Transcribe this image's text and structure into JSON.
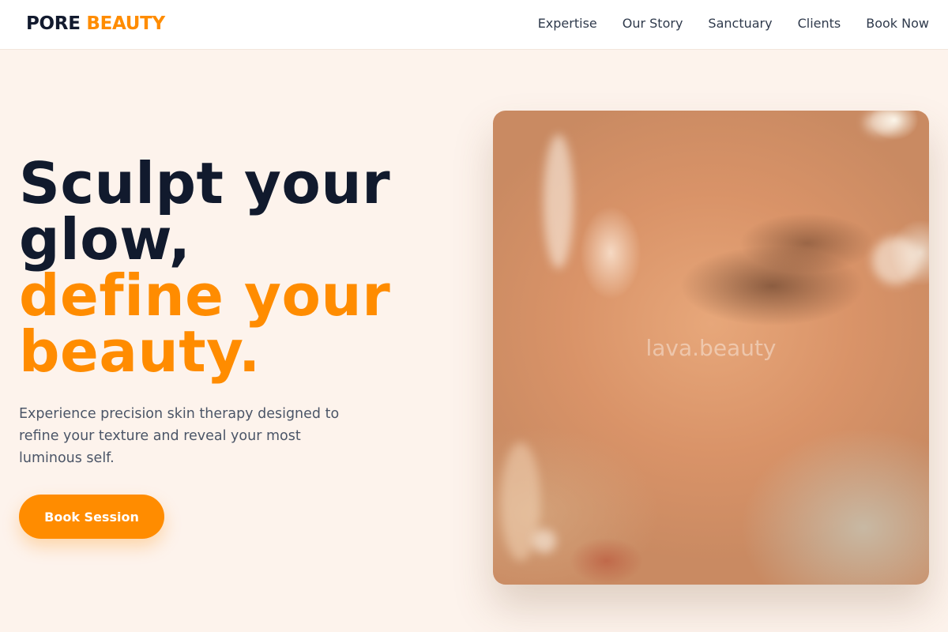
{
  "brand": {
    "name_part1": "PORE",
    "name_part2": "BEAUTY",
    "color_dark": "#121a2e",
    "color_accent": "#ff8c00"
  },
  "nav": {
    "items": [
      "Expertise",
      "Our Story",
      "Sanctuary",
      "Clients",
      "Book Now"
    ]
  },
  "hero": {
    "title_line1": "Sculpt your",
    "title_line2": "glow,",
    "title_line3": "define your",
    "title_line4": "beauty.",
    "description": "Experience precision skin therapy designed to refine your texture and reveal your most luminous self.",
    "cta_label": "Book Session"
  },
  "image": {
    "watermark": "lava.beauty"
  },
  "colors": {
    "background": "#fdf3ec",
    "accent": "#ff8c00",
    "button_text": "#ffffff"
  }
}
